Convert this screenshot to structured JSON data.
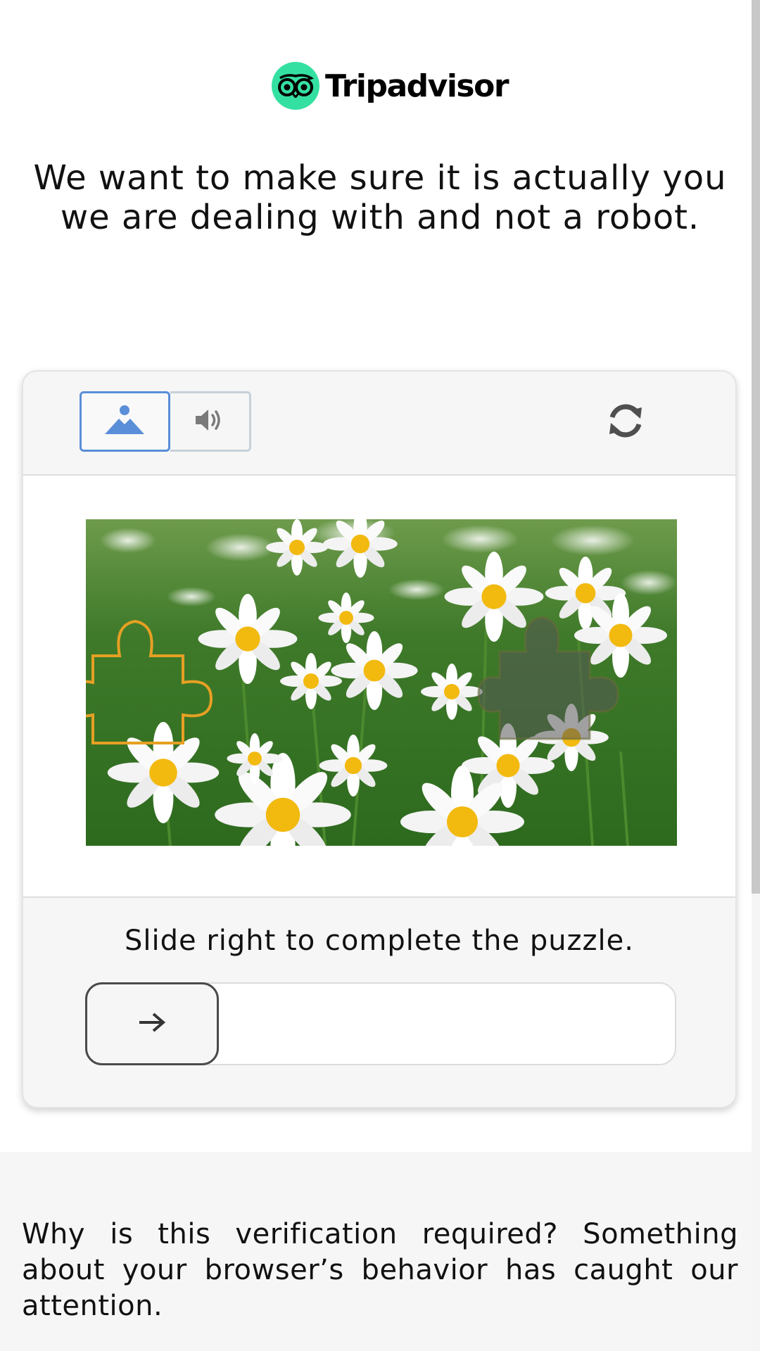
{
  "brand": {
    "name": "Tripadvisor",
    "accent_color": "#34e0a1"
  },
  "headline": "We want to make sure it is actually you we are dealing with and not a robot.",
  "captcha": {
    "modes": [
      {
        "name": "image",
        "icon": "image-icon",
        "selected": true
      },
      {
        "name": "audio",
        "icon": "speaker-icon",
        "selected": false
      }
    ],
    "refresh_icon": "refresh-icon",
    "puzzle_image_subject": "daisy-field",
    "instruction": "Slide right to complete the puzzle.",
    "slider": {
      "icon": "arrow-right-icon",
      "progress": 0
    }
  },
  "why_text": "Why is this verification required? Something about your browser’s behavior has caught our attention."
}
